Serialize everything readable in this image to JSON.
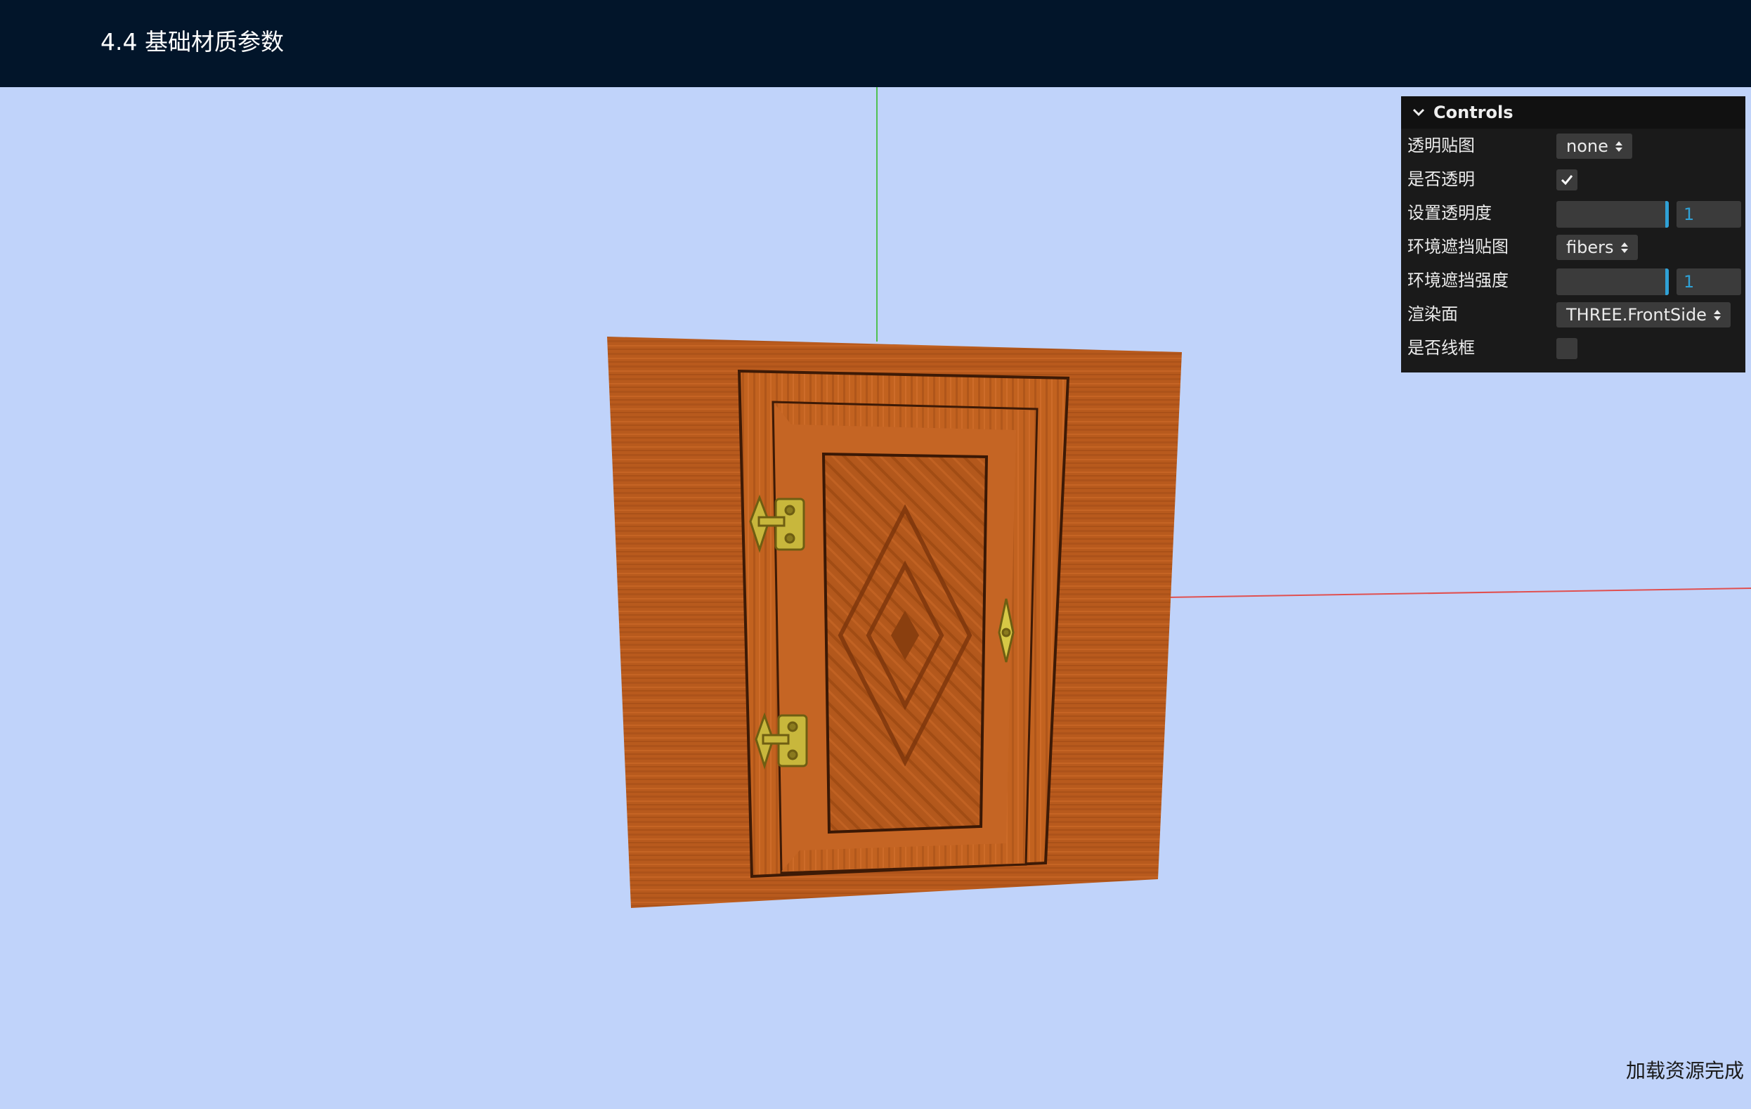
{
  "header": {
    "title": "4.4 基础材质参数"
  },
  "colors": {
    "header_bg": "#02152a",
    "scene_bg": "#c0d3fa",
    "wood": "#b85a1d",
    "brass": "#c8b73c",
    "axis_x": "#e05050",
    "axis_y": "#50c050",
    "gui_bg": "#1a1a1a",
    "gui_accent": "#2fa1d6"
  },
  "scene": {
    "object": "door-panel",
    "axes": [
      "x-axis",
      "y-axis"
    ]
  },
  "controls": {
    "title": "Controls",
    "rows": {
      "alpha_map": {
        "label": "透明贴图",
        "value": "none"
      },
      "transparent": {
        "label": "是否透明",
        "checked": true
      },
      "opacity": {
        "label": "设置透明度",
        "value": "1",
        "level": 1
      },
      "ao_map": {
        "label": "环境遮挡贴图",
        "value": "fibers"
      },
      "ao_intensity": {
        "label": "环境遮挡强度",
        "value": "1",
        "level": 1
      },
      "side": {
        "label": "渲染面",
        "value": "THREE.FrontSide"
      },
      "wireframe": {
        "label": "是否线框",
        "checked": false
      }
    }
  },
  "status": {
    "text": "加载资源完成"
  }
}
